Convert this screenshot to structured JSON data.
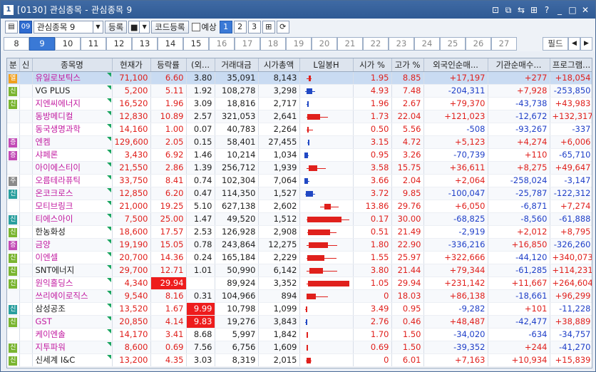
{
  "window": {
    "num": "1",
    "title": "[0130] 관심종목 - 관심종목 9"
  },
  "toolbar": {
    "group": "관심종목 9",
    "reg": "등록",
    "code_reg": "코드등록",
    "yesang": "예상",
    "pages": [
      "1",
      "2",
      "3"
    ]
  },
  "tabs": [
    "8",
    "9",
    "10",
    "11",
    "12",
    "13",
    "14",
    "15",
    "16",
    "17",
    "18",
    "19",
    "20",
    "21",
    "22",
    "23",
    "24",
    "25",
    "26",
    "27"
  ],
  "active_tab": "9",
  "filter": "필드",
  "columns": [
    "분",
    "신",
    "종목명",
    "현재가",
    "등락률",
    "(외...",
    "거래대금",
    "시가총액",
    "L일봉H",
    "시가 %",
    "고가 %",
    "외국인순매...",
    "기관순매수...",
    "프로그램..."
  ],
  "rows": [
    {
      "b": "열",
      "bc": "#f0a020",
      "name": "유일로보틱스",
      "nc": "pk",
      "price": "71,100",
      "chg": "6.60",
      "fr": "3.80",
      "vol": "35,091",
      "cap": "8,143",
      "open": "1.95",
      "high": "8.85",
      "fi": "+17,197",
      "inst": "+277",
      "prog": "+18,054",
      "candle": [
        0.05,
        0.14,
        0.08,
        0.12,
        1
      ],
      "sel": true
    },
    {
      "b": "신",
      "bc": "#7ab531",
      "name": "VG PLUS",
      "nc": "bk",
      "price": "5,200",
      "chg": "5.11",
      "fr": "1.92",
      "vol": "108,278",
      "cap": "3,298",
      "open": "4.93",
      "high": "7.48",
      "fi": "-204,311",
      "inst": "+7,928",
      "prog": "-253,850",
      "candle": [
        0.02,
        0.2,
        0.04,
        0.15,
        0
      ]
    },
    {
      "b": "신",
      "bc": "#7ab531",
      "name": "지엔씨에너지",
      "nc": "pk",
      "price": "16,520",
      "chg": "1.96",
      "fr": "3.09",
      "vol": "18,816",
      "cap": "2,717",
      "open": "1.96",
      "high": "2.67",
      "fi": "+79,370",
      "inst": "-43,738",
      "prog": "+43,983",
      "candle": [
        0.05,
        0.08,
        0.06,
        0.07,
        0
      ]
    },
    {
      "b": "",
      "bc": "",
      "name": "동방메디컬",
      "nc": "pk",
      "price": "12,830",
      "chg": "10.89",
      "fr": "2.57",
      "vol": "321,053",
      "cap": "2,641",
      "open": "1.73",
      "high": "22.04",
      "fi": "+121,023",
      "inst": "-12,672",
      "prog": "+132,317",
      "candle": [
        0.04,
        0.45,
        0.06,
        0.3,
        1
      ]
    },
    {
      "b": "",
      "bc": "",
      "name": "동국생명과학",
      "nc": "pk",
      "price": "14,160",
      "chg": "1.00",
      "fr": "0.07",
      "vol": "40,783",
      "cap": "2,264",
      "open": "0.50",
      "high": "5.56",
      "fi": "-508",
      "inst": "-93,267",
      "prog": "-337",
      "candle": [
        0.04,
        0.16,
        0.06,
        0.08,
        1
      ]
    },
    {
      "b": "증",
      "bc": "#c24bb6",
      "name": "엔켐",
      "nc": "pk",
      "price": "129,600",
      "chg": "2.05",
      "fr": "0.15",
      "vol": "58,401",
      "cap": "27,455",
      "open": "3.15",
      "high": "4.72",
      "fi": "+5,123",
      "inst": "+4,274",
      "prog": "+6,006",
      "candle": [
        0.06,
        0.1,
        0.07,
        0.09,
        0
      ]
    },
    {
      "b": "증",
      "bc": "#c24bb6",
      "name": "샤페론",
      "nc": "pk",
      "price": "3,430",
      "chg": "6.92",
      "fr": "1.46",
      "vol": "10,214",
      "cap": "1,034",
      "open": "0.95",
      "high": "3.26",
      "fi": "-70,739",
      "inst": "+110",
      "prog": "-65,710",
      "candle": [
        0.0,
        0.08,
        0.01,
        0.07,
        0
      ]
    },
    {
      "b": "",
      "bc": "",
      "name": "아이에스티이",
      "nc": "pk",
      "price": "21,550",
      "chg": "2.86",
      "fr": "1.39",
      "vol": "256,712",
      "cap": "1,939",
      "open": "3.58",
      "high": "15.75",
      "fi": "+36,611",
      "inst": "+8,275",
      "prog": "+49,647",
      "candle": [
        0.04,
        0.4,
        0.09,
        0.25,
        1
      ]
    },
    {
      "b": "주",
      "bc": "#8a8a8a",
      "name": "오름테라퓨틱",
      "nc": "pk",
      "price": "33,750",
      "chg": "8.41",
      "fr": "0.74",
      "vol": "102,304",
      "cap": "7,064",
      "open": "3.66",
      "high": "2.04",
      "fi": "+2,064",
      "inst": "-258,024",
      "prog": "-3,147",
      "candle": [
        0.0,
        0.1,
        0.0,
        0.07,
        0
      ]
    },
    {
      "b": "신",
      "bc": "#2a9f9f",
      "name": "온코크로스",
      "nc": "pk",
      "price": "12,850",
      "chg": "6.20",
      "fr": "0.47",
      "vol": "114,350",
      "cap": "1,527",
      "open": "3.72",
      "high": "9.85",
      "fi": "-100,047",
      "inst": "-25,787",
      "prog": "-122,312",
      "candle": [
        0.02,
        0.2,
        0.03,
        0.16,
        0
      ]
    },
    {
      "b": "",
      "bc": "",
      "name": "모티브링크",
      "nc": "pk",
      "price": "21,000",
      "chg": "19.25",
      "fr": "5.10",
      "vol": "627,138",
      "cap": "2,602",
      "open": "13.86",
      "high": "29.76",
      "fi": "+6,050",
      "inst": "-6,871",
      "prog": "+7,274",
      "candle": [
        0.3,
        0.65,
        0.38,
        0.5,
        1
      ]
    },
    {
      "b": "신",
      "bc": "#2a9f9f",
      "name": "티에스아이",
      "nc": "pk",
      "price": "7,500",
      "chg": "25.00",
      "fr": "1.47",
      "vol": "49,520",
      "cap": "1,512",
      "open": "0.17",
      "high": "30.00",
      "fi": "-68,825",
      "inst": "-8,560",
      "prog": "-61,888",
      "candle": [
        0.05,
        0.85,
        0.06,
        0.7,
        1
      ]
    },
    {
      "b": "신",
      "bc": "#7ab531",
      "name": "한농화성",
      "nc": "bk",
      "price": "18,600",
      "chg": "17.57",
      "fr": "2.53",
      "vol": "126,928",
      "cap": "2,908",
      "open": "0.51",
      "high": "21.49",
      "fi": "-2,919",
      "inst": "+2,012",
      "prog": "+8,795",
      "candle": [
        0.06,
        0.6,
        0.07,
        0.48,
        1
      ]
    },
    {
      "b": "증",
      "bc": "#c24bb6",
      "name": "금양",
      "nc": "pk",
      "price": "19,190",
      "chg": "15.05",
      "fr": "0.78",
      "vol": "243,864",
      "cap": "12,275",
      "open": "1.80",
      "high": "22.90",
      "fi": "-336,216",
      "inst": "+16,850",
      "prog": "-326,260",
      "candle": [
        0.04,
        0.62,
        0.08,
        0.44,
        1
      ]
    },
    {
      "b": "신",
      "bc": "#7ab531",
      "name": "이엔셀",
      "nc": "pk",
      "price": "20,700",
      "chg": "14.36",
      "fr": "0.24",
      "vol": "165,184",
      "cap": "2,229",
      "open": "1.55",
      "high": "25.97",
      "fi": "+322,666",
      "inst": "-44,120",
      "prog": "+340,073",
      "candle": [
        0.04,
        0.6,
        0.06,
        0.38,
        1
      ]
    },
    {
      "b": "신",
      "bc": "#7ab531",
      "name": "SNT에너지",
      "nc": "bk",
      "price": "29,700",
      "chg": "12.71",
      "fr": "1.01",
      "vol": "50,990",
      "cap": "6,142",
      "open": "3.80",
      "high": "21.44",
      "fi": "+79,344",
      "inst": "-61,285",
      "prog": "+114,231",
      "candle": [
        0.05,
        0.62,
        0.1,
        0.35,
        1
      ]
    },
    {
      "b": "신",
      "bc": "#7ab531",
      "name": "원익홀딩스",
      "nc": "pk",
      "price": "4,340",
      "chg": "29.94",
      "fr": "",
      "vol": "89,924",
      "cap": "3,352",
      "open": "1.05",
      "high": "29.94",
      "fi": "+231,142",
      "inst": "+11,667",
      "prog": "+264,604",
      "candle": [
        0.05,
        0.85,
        0.07,
        0.85,
        1
      ],
      "hlchg": true
    },
    {
      "b": "",
      "bc": "",
      "name": "쓰리에이로직스",
      "nc": "pk",
      "price": "9,540",
      "chg": "8.16",
      "fr": "0.31",
      "vol": "104,966",
      "cap": "894",
      "open": "0",
      "high": "18.03",
      "fi": "+86,138",
      "inst": "-18,661",
      "prog": "+96,299",
      "candle": [
        0.05,
        0.45,
        0.05,
        0.22,
        1
      ]
    },
    {
      "b": "신",
      "bc": "#2a9f9f",
      "name": "삼성공조",
      "nc": "bk",
      "price": "13,520",
      "chg": "1.67",
      "fr": "9.99",
      "vol": "10,798",
      "cap": "1,099",
      "open": "3.49",
      "high": "0.95",
      "fi": "-9,282",
      "inst": "+101",
      "prog": "-11,228",
      "candle": [
        0.02,
        0.06,
        0.03,
        0.05,
        1
      ],
      "hlfr": true
    },
    {
      "b": "신",
      "bc": "#7ab531",
      "name": "GST",
      "nc": "pk",
      "price": "20,850",
      "chg": "4.14",
      "fr": "9.83",
      "vol": "19,276",
      "cap": "3,843",
      "open": "2.76",
      "high": "0.46",
      "fi": "+48,487",
      "inst": "-42,477",
      "prog": "+38,889",
      "candle": [
        0.02,
        0.05,
        0.03,
        0.05,
        0
      ],
      "hlfr": true
    },
    {
      "b": "",
      "bc": "",
      "name": "케이엔솔",
      "nc": "pk",
      "price": "14,170",
      "chg": "3.41",
      "fr": "8.68",
      "vol": "5,997",
      "cap": "1,842",
      "open": "1.70",
      "high": "1.50",
      "fi": "-34,020",
      "inst": "-634",
      "prog": "-34,757",
      "candle": [
        0.04,
        0.06,
        0.05,
        0.06,
        1
      ]
    },
    {
      "b": "신",
      "bc": "#7ab531",
      "name": "지투파워",
      "nc": "pk",
      "price": "8,600",
      "chg": "0.69",
      "fr": "7.56",
      "vol": "6,756",
      "cap": "1,609",
      "open": "0.69",
      "high": "1.50",
      "fi": "-39,352",
      "inst": "+244",
      "prog": "-41,270",
      "candle": [
        0.04,
        0.07,
        0.05,
        0.06,
        1
      ]
    },
    {
      "b": "신",
      "bc": "#7ab531",
      "name": "신세계 I&C",
      "nc": "bk",
      "price": "13,200",
      "chg": "4.35",
      "fr": "3.03",
      "vol": "8,319",
      "cap": "2,015",
      "open": "0",
      "high": "6.01",
      "fi": "+7,163",
      "inst": "+10,934",
      "prog": "+15,839",
      "candle": [
        0.03,
        0.14,
        0.04,
        0.12,
        1
      ]
    }
  ]
}
